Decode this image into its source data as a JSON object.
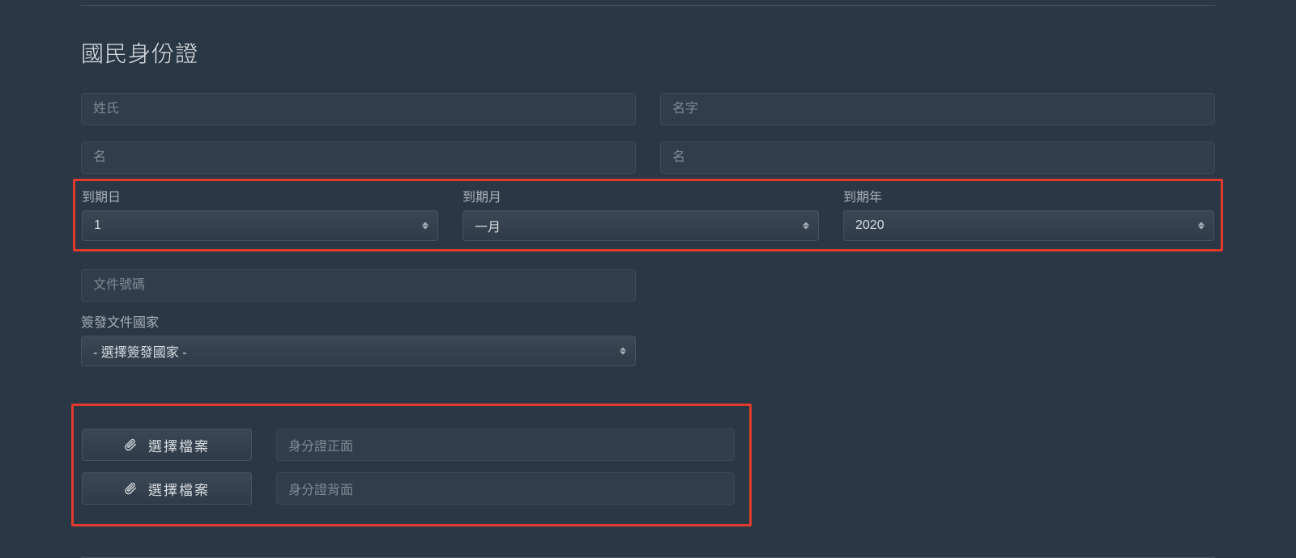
{
  "section_title": "國民身份證",
  "fields": {
    "surname_placeholder": "姓氏",
    "given_name_placeholder": "名字",
    "name_left_placeholder": "名",
    "name_right_placeholder": "名",
    "doc_number_placeholder": "文件號碼"
  },
  "expiry": {
    "day_label": "到期日",
    "day_value": "1",
    "month_label": "到期月",
    "month_value": "一月",
    "year_label": "到期年",
    "year_value": "2020"
  },
  "issuing_country": {
    "label": "簽發文件國家",
    "value": "- 選擇簽發國家 -"
  },
  "file_upload": {
    "button_label": "選擇檔案",
    "front_placeholder": "身分證正面",
    "back_placeholder": "身分證背面"
  }
}
